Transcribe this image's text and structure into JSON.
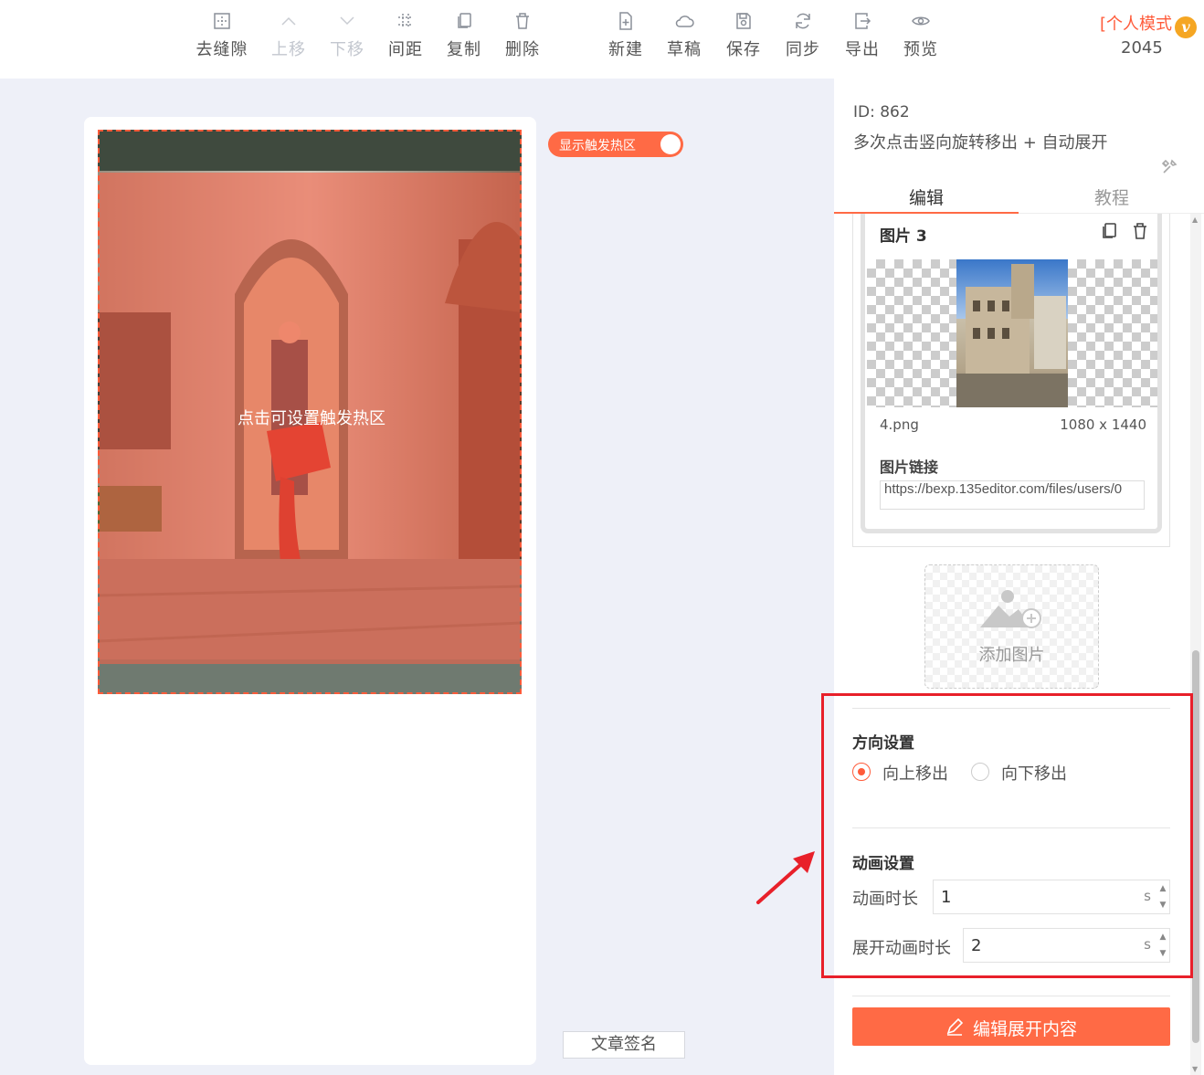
{
  "toolbar": {
    "items": [
      {
        "label": "去缝隙",
        "icon": "gap-remove-icon",
        "disabled": false
      },
      {
        "label": "上移",
        "icon": "arrow-up-icon",
        "disabled": true
      },
      {
        "label": "下移",
        "icon": "arrow-down-icon",
        "disabled": true
      },
      {
        "label": "间距",
        "icon": "spacing-icon",
        "disabled": false
      },
      {
        "label": "复制",
        "icon": "copy-icon",
        "disabled": false
      },
      {
        "label": "删除",
        "icon": "trash-icon",
        "disabled": false
      },
      {
        "label": "新建",
        "icon": "new-file-icon",
        "disabled": false
      },
      {
        "label": "草稿",
        "icon": "cloud-icon",
        "disabled": false
      },
      {
        "label": "保存",
        "icon": "save-icon",
        "disabled": false
      },
      {
        "label": "同步",
        "icon": "sync-icon",
        "disabled": false
      },
      {
        "label": "导出",
        "icon": "export-icon",
        "disabled": false
      },
      {
        "label": "预览",
        "icon": "eye-icon",
        "disabled": false
      }
    ],
    "mode_label": "[个人模式",
    "mode_badge": "v",
    "mode_number": "2045"
  },
  "canvas": {
    "toggle_label": "显示触发热区",
    "toggle_on": true,
    "hotzone_text": "点击可设置触发热区",
    "signature_button": "文章签名"
  },
  "panel": {
    "id_text": "ID: 862",
    "template_name": "多次点击竖向旋转移出 + 自动展开",
    "tabs": [
      "编辑",
      "教程"
    ],
    "active_tab": "编辑",
    "image_card": {
      "title": "图片 3",
      "file_name": "4.png",
      "dimensions": "1080 x 1440",
      "link_label": "图片链接",
      "link_value": "https://bexp.135editor.com/files/users/0"
    },
    "add_image_label": "添加图片",
    "direction": {
      "title": "方向设置",
      "options": [
        "向上移出",
        "向下移出"
      ],
      "selected": "向上移出"
    },
    "animation": {
      "title": "动画设置",
      "duration_label": "动画时长",
      "duration_value": "1",
      "expand_label": "展开动画时长",
      "expand_value": "2",
      "unit": "s"
    },
    "edit_button": "编辑展开内容"
  },
  "colors": {
    "accent": "#ff6a45",
    "annotation": "#e8202a",
    "canvas_bg": "#eef0f8"
  }
}
